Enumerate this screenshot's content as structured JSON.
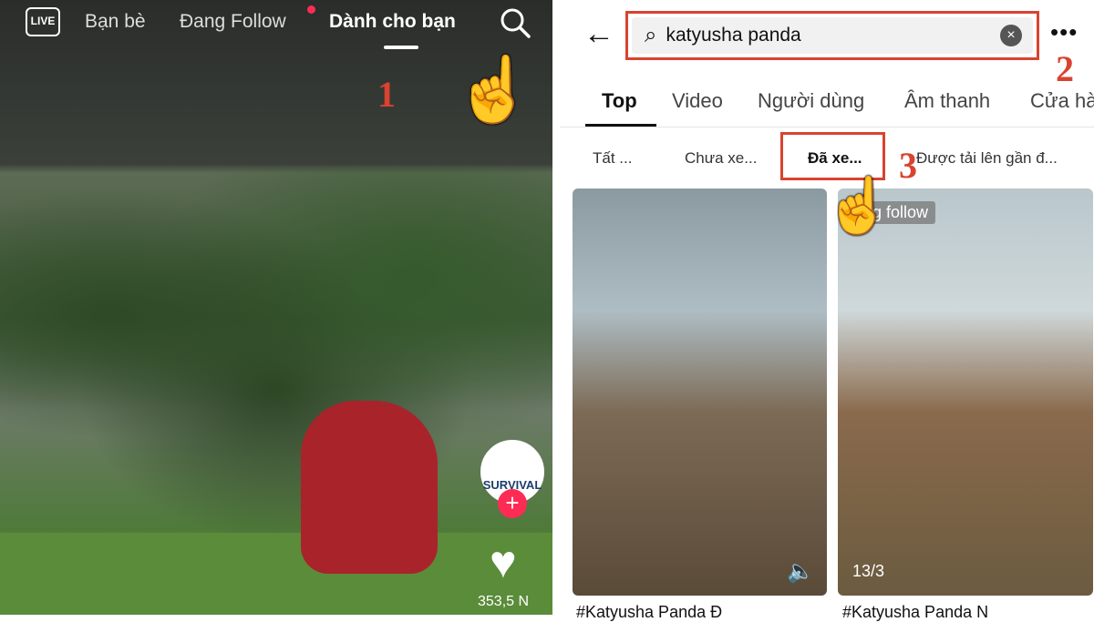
{
  "left": {
    "live_label": "LIVE",
    "tabs": [
      "Bạn bè",
      "Đang Follow",
      "Dành cho bạn"
    ],
    "active_tab": "Dành cho bạn",
    "creator_avatar_text": "SURVIVAL",
    "like_count": "353,5 N",
    "step": "1"
  },
  "right": {
    "search_value": "katyusha panda",
    "step_search": "2",
    "tabs": [
      "Top",
      "Video",
      "Người dùng",
      "Âm thanh",
      "Cửa hà"
    ],
    "filters": [
      "Tất ...",
      "Chưa xe...",
      "Đã xe...",
      "Được tải lên gần đ..."
    ],
    "step_filter": "3",
    "cards": [
      {
        "badge": "",
        "count": "",
        "title": "#Katyusha Panda Đ"
      },
      {
        "badge": "ng follow",
        "count": "13/3",
        "title": "#Katyusha Panda N"
      }
    ]
  },
  "colors": {
    "annotation": "#d9432f",
    "accent": "#fe2c55"
  }
}
